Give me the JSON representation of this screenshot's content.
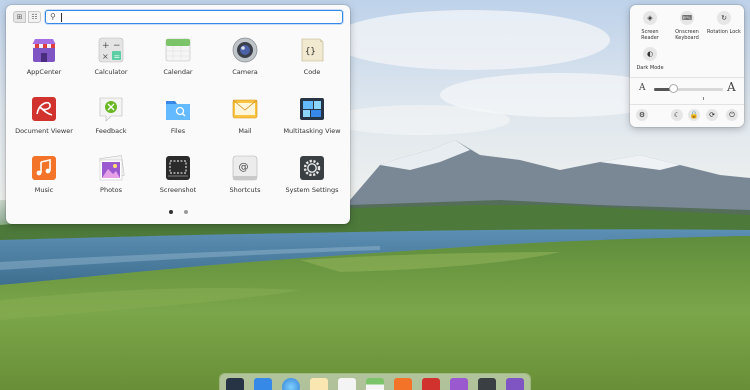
{
  "launcher": {
    "view_modes": [
      {
        "icon": "grid-view-icon",
        "glyph": "⊞"
      },
      {
        "icon": "category-view-icon",
        "glyph": "☷"
      }
    ],
    "search": {
      "value": "",
      "icon": "search-icon"
    },
    "apps": [
      {
        "label": "AppCenter",
        "icon": "appcenter-icon"
      },
      {
        "label": "Calculator",
        "icon": "calculator-icon"
      },
      {
        "label": "Calendar",
        "icon": "calendar-icon"
      },
      {
        "label": "Camera",
        "icon": "camera-icon"
      },
      {
        "label": "Code",
        "icon": "code-icon"
      },
      {
        "label": "Document Viewer",
        "icon": "document-viewer-icon"
      },
      {
        "label": "Feedback",
        "icon": "feedback-icon"
      },
      {
        "label": "Files",
        "icon": "files-icon"
      },
      {
        "label": "Mail",
        "icon": "mail-icon"
      },
      {
        "label": "Multitasking View",
        "icon": "multitasking-view-icon"
      },
      {
        "label": "Music",
        "icon": "music-icon"
      },
      {
        "label": "Photos",
        "icon": "photos-icon"
      },
      {
        "label": "Screenshot",
        "icon": "screenshot-icon"
      },
      {
        "label": "Shortcuts",
        "icon": "shortcuts-icon"
      },
      {
        "label": "System Settings",
        "icon": "system-settings-icon"
      }
    ],
    "pages": {
      "count": 2,
      "current": 1
    }
  },
  "quick_settings": {
    "toggles": [
      {
        "label": "Screen Reader",
        "icon": "screen-reader-icon"
      },
      {
        "label": "Onscreen Keyboard",
        "icon": "onscreen-keyboard-icon"
      },
      {
        "label": "Rotation Lock",
        "icon": "rotation-lock-icon"
      },
      {
        "label": "Dark Mode",
        "icon": "dark-mode-icon"
      }
    ],
    "text_scale": {
      "small_label": "A",
      "large_label": "A",
      "value_fraction": 0.27
    },
    "actions": [
      {
        "icon": "settings-gear-icon",
        "glyph": "⚙"
      },
      {
        "icon": "suspend-icon",
        "glyph": "☾"
      },
      {
        "icon": "lock-icon",
        "glyph": "🔒"
      },
      {
        "icon": "logout-icon",
        "glyph": "⟳"
      },
      {
        "icon": "power-icon",
        "glyph": "⏻"
      }
    ]
  },
  "dock": {
    "items": [
      {
        "icon": "multitasking-view-icon"
      },
      {
        "icon": "files-icon"
      },
      {
        "icon": "web-browser-icon"
      },
      {
        "icon": "mail-icon"
      },
      {
        "icon": "tasks-icon"
      },
      {
        "icon": "calendar-icon"
      },
      {
        "icon": "music-icon"
      },
      {
        "icon": "videos-icon"
      },
      {
        "icon": "photos-icon"
      },
      {
        "icon": "system-settings-icon"
      },
      {
        "icon": "appcenter-icon"
      }
    ]
  }
}
